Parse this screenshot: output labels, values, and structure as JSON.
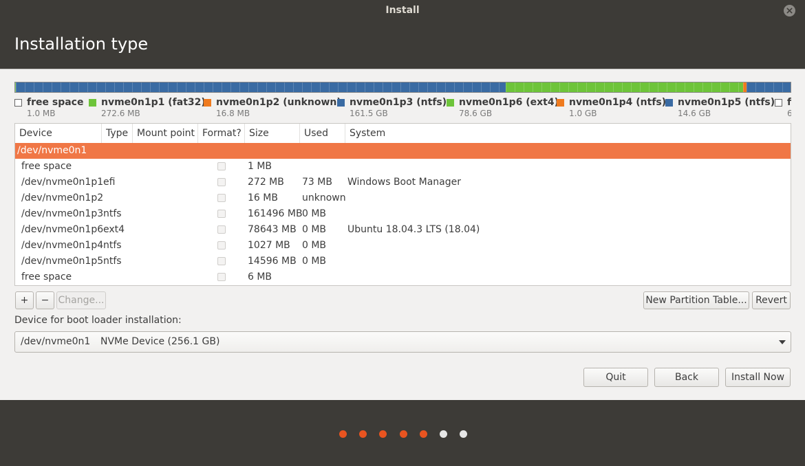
{
  "window": {
    "title": "Install"
  },
  "header": {
    "title": "Installation type"
  },
  "disk_bar": [
    {
      "color": "#3a6ba3",
      "fraction": 0.0001
    },
    {
      "color": "#6ec43a",
      "fraction": 0.0011
    },
    {
      "color": "#ef7b1f",
      "fraction": 0.0001
    },
    {
      "color": "#3a6ba3",
      "fraction": 0.6694
    },
    {
      "color": "#6ec43a",
      "fraction": 0.3252
    },
    {
      "color": "#ef7b1f",
      "fraction": 0.0042
    },
    {
      "color": "#3a6ba3",
      "fraction": 0.0604
    }
  ],
  "legend": [
    {
      "name": "free space",
      "size": "1.0 MB",
      "color": "#ffffff"
    },
    {
      "name": "nvme0n1p1 (fat32)",
      "size": "272.6 MB",
      "color": "#6ec43a"
    },
    {
      "name": "nvme0n1p2 (unknown)",
      "size": "16.8 MB",
      "color": "#ef7b1f"
    },
    {
      "name": "nvme0n1p3 (ntfs)",
      "size": "161.5 GB",
      "color": "#3a6ba3"
    },
    {
      "name": "nvme0n1p6 (ext4)",
      "size": "78.6 GB",
      "color": "#6ec43a"
    },
    {
      "name": "nvme0n1p4 (ntfs)",
      "size": "1.0 GB",
      "color": "#ef7b1f"
    },
    {
      "name": "nvme0n1p5 (ntfs)",
      "size": "14.6 GB",
      "color": "#3a6ba3"
    },
    {
      "name": "free space",
      "size": "6",
      "color": "#ffffff"
    }
  ],
  "table": {
    "columns": [
      "Device",
      "Type",
      "Mount point",
      "Format?",
      "Size",
      "Used",
      "System"
    ],
    "rows": [
      {
        "device": "/dev/nvme0n1",
        "type": "",
        "mount": "",
        "size": "",
        "used": "",
        "system": "",
        "selected": true,
        "checkbox": false
      },
      {
        "device": "free space",
        "type": "",
        "mount": "",
        "size": "1 MB",
        "used": "",
        "system": "",
        "selected": false,
        "checkbox": true
      },
      {
        "device": "/dev/nvme0n1p1",
        "type": "efi",
        "mount": "",
        "size": "272 MB",
        "used": "73 MB",
        "system": "Windows Boot Manager",
        "selected": false,
        "checkbox": true
      },
      {
        "device": "/dev/nvme0n1p2",
        "type": "",
        "mount": "",
        "size": "16 MB",
        "used": "unknown",
        "system": "",
        "selected": false,
        "checkbox": true
      },
      {
        "device": "/dev/nvme0n1p3",
        "type": "ntfs",
        "mount": "",
        "size": "161496 MB",
        "used": "0 MB",
        "system": "",
        "selected": false,
        "checkbox": true
      },
      {
        "device": "/dev/nvme0n1p6",
        "type": "ext4",
        "mount": "",
        "size": "78643 MB",
        "used": "0 MB",
        "system": "Ubuntu 18.04.3 LTS (18.04)",
        "selected": false,
        "checkbox": true
      },
      {
        "device": "/dev/nvme0n1p4",
        "type": "ntfs",
        "mount": "",
        "size": "1027 MB",
        "used": "0 MB",
        "system": "",
        "selected": false,
        "checkbox": true
      },
      {
        "device": "/dev/nvme0n1p5",
        "type": "ntfs",
        "mount": "",
        "size": "14596 MB",
        "used": "0 MB",
        "system": "",
        "selected": false,
        "checkbox": true
      },
      {
        "device": "free space",
        "type": "",
        "mount": "",
        "size": "6 MB",
        "used": "",
        "system": "",
        "selected": false,
        "checkbox": true
      }
    ]
  },
  "toolbar": {
    "add_label": "+",
    "remove_label": "−",
    "change_label": "Change...",
    "new_partition_table_label": "New Partition Table...",
    "revert_label": "Revert"
  },
  "bootloader": {
    "label": "Device for boot loader installation:",
    "device": "/dev/nvme0n1",
    "description": "NVMe Device (256.1 GB)"
  },
  "actions": {
    "quit": "Quit",
    "back": "Back",
    "install_now": "Install Now"
  },
  "progress": {
    "total_steps": 7,
    "completed_steps": 5,
    "active_color": "#e95420",
    "inactive_color": "#e6e6e6"
  }
}
